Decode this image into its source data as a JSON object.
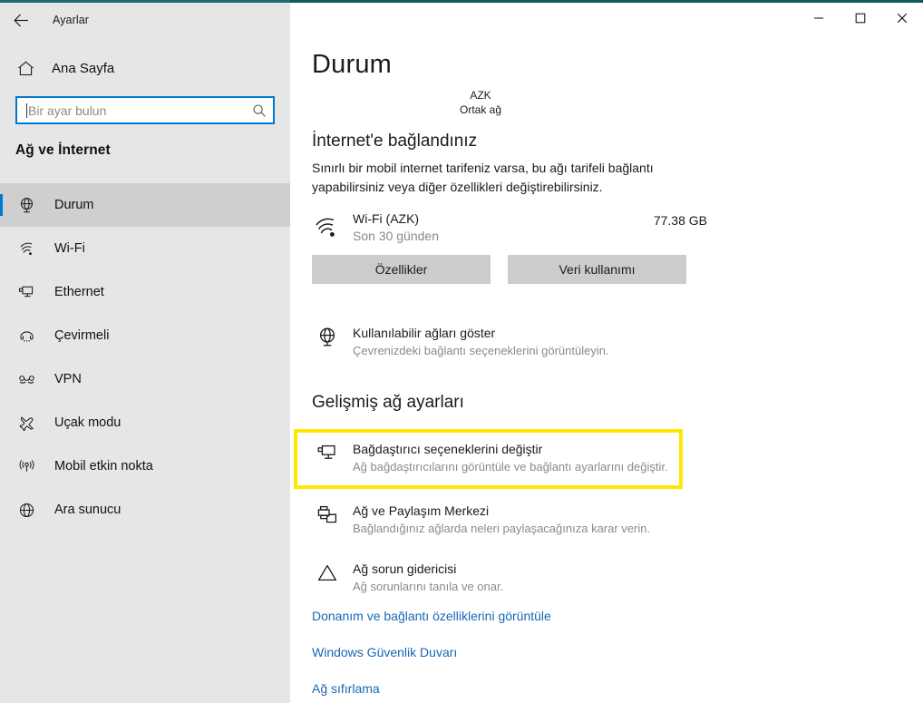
{
  "window": {
    "app_title": "Ayarlar",
    "back_icon": "back-arrow-icon",
    "minimize_label": "─",
    "maximize_label": "□",
    "close_label": "✕",
    "chrome_color": "#0e5a5e"
  },
  "sidebar": {
    "home": {
      "label": "Ana Sayfa",
      "icon": "home-icon"
    },
    "search": {
      "value": "",
      "placeholder": "Bir ayar bulun",
      "icon": "search-icon",
      "focus_color": "#0078d4"
    },
    "heading": "Ağ ve İnternet",
    "items": [
      {
        "label": "Durum",
        "icon": "status-globe-icon",
        "selected": true
      },
      {
        "label": "Wi-Fi",
        "icon": "wifi-icon",
        "selected": false
      },
      {
        "label": "Ethernet",
        "icon": "ethernet-icon",
        "selected": false
      },
      {
        "label": "Çevirmeli",
        "icon": "dialup-icon",
        "selected": false
      },
      {
        "label": "VPN",
        "icon": "vpn-icon",
        "selected": false
      },
      {
        "label": "Uçak modu",
        "icon": "airplane-icon",
        "selected": false
      },
      {
        "label": "Mobil etkin nokta",
        "icon": "hotspot-icon",
        "selected": false
      },
      {
        "label": "Ara sunucu",
        "icon": "proxy-globe-icon",
        "selected": false
      }
    ],
    "selection_color": "#0078d4"
  },
  "main": {
    "page_title": "Durum",
    "network": {
      "name": "AZK",
      "type": "Ortak ağ"
    },
    "status": {
      "heading": "İnternet'e bağlandınız",
      "description": "Sınırlı bir mobil internet tarifeniz varsa, bu ağı tarifeli bağlantı yapabilirsiniz veya diğer özellikleri değiştirebilirsiniz."
    },
    "usage": {
      "icon": "wifi-signal-icon",
      "title": "Wi-Fi (AZK)",
      "subtitle": "Son 30 günden",
      "amount": "77.38 GB"
    },
    "buttons": {
      "properties": "Özellikler",
      "data_usage": "Veri kullanımı"
    },
    "available_networks": {
      "icon": "globe-network-icon",
      "title": "Kullanılabilir ağları göster",
      "subtitle": "Çevrenizdeki bağlantı seçeneklerini görüntüleyin."
    },
    "advanced_heading": "Gelişmiş ağ ayarları",
    "advanced_items": [
      {
        "icon": "adapter-monitor-icon",
        "title": "Bağdaştırıcı seçeneklerini değiştir",
        "subtitle": "Ağ bağdaştırıcılarını görüntüle ve bağlantı ayarlarını değiştir.",
        "highlighted": true
      },
      {
        "icon": "sharing-printer-icon",
        "title": "Ağ ve Paylaşım Merkezi",
        "subtitle": "Bağlandığınız ağlarda neleri paylaşacağınıza karar verin.",
        "highlighted": false
      },
      {
        "icon": "warning-triangle-icon",
        "title": "Ağ sorun gidericisi",
        "subtitle": "Ağ sorunlarını tanıla ve onar.",
        "highlighted": false
      }
    ],
    "links": [
      {
        "label": "Donanım ve bağlantı özelliklerini görüntüle"
      },
      {
        "label": "Windows Güvenlik Duvarı"
      },
      {
        "label": "Ağ sıfırlama"
      }
    ],
    "link_color": "#1668b3",
    "highlight_color": "#ffe800"
  }
}
